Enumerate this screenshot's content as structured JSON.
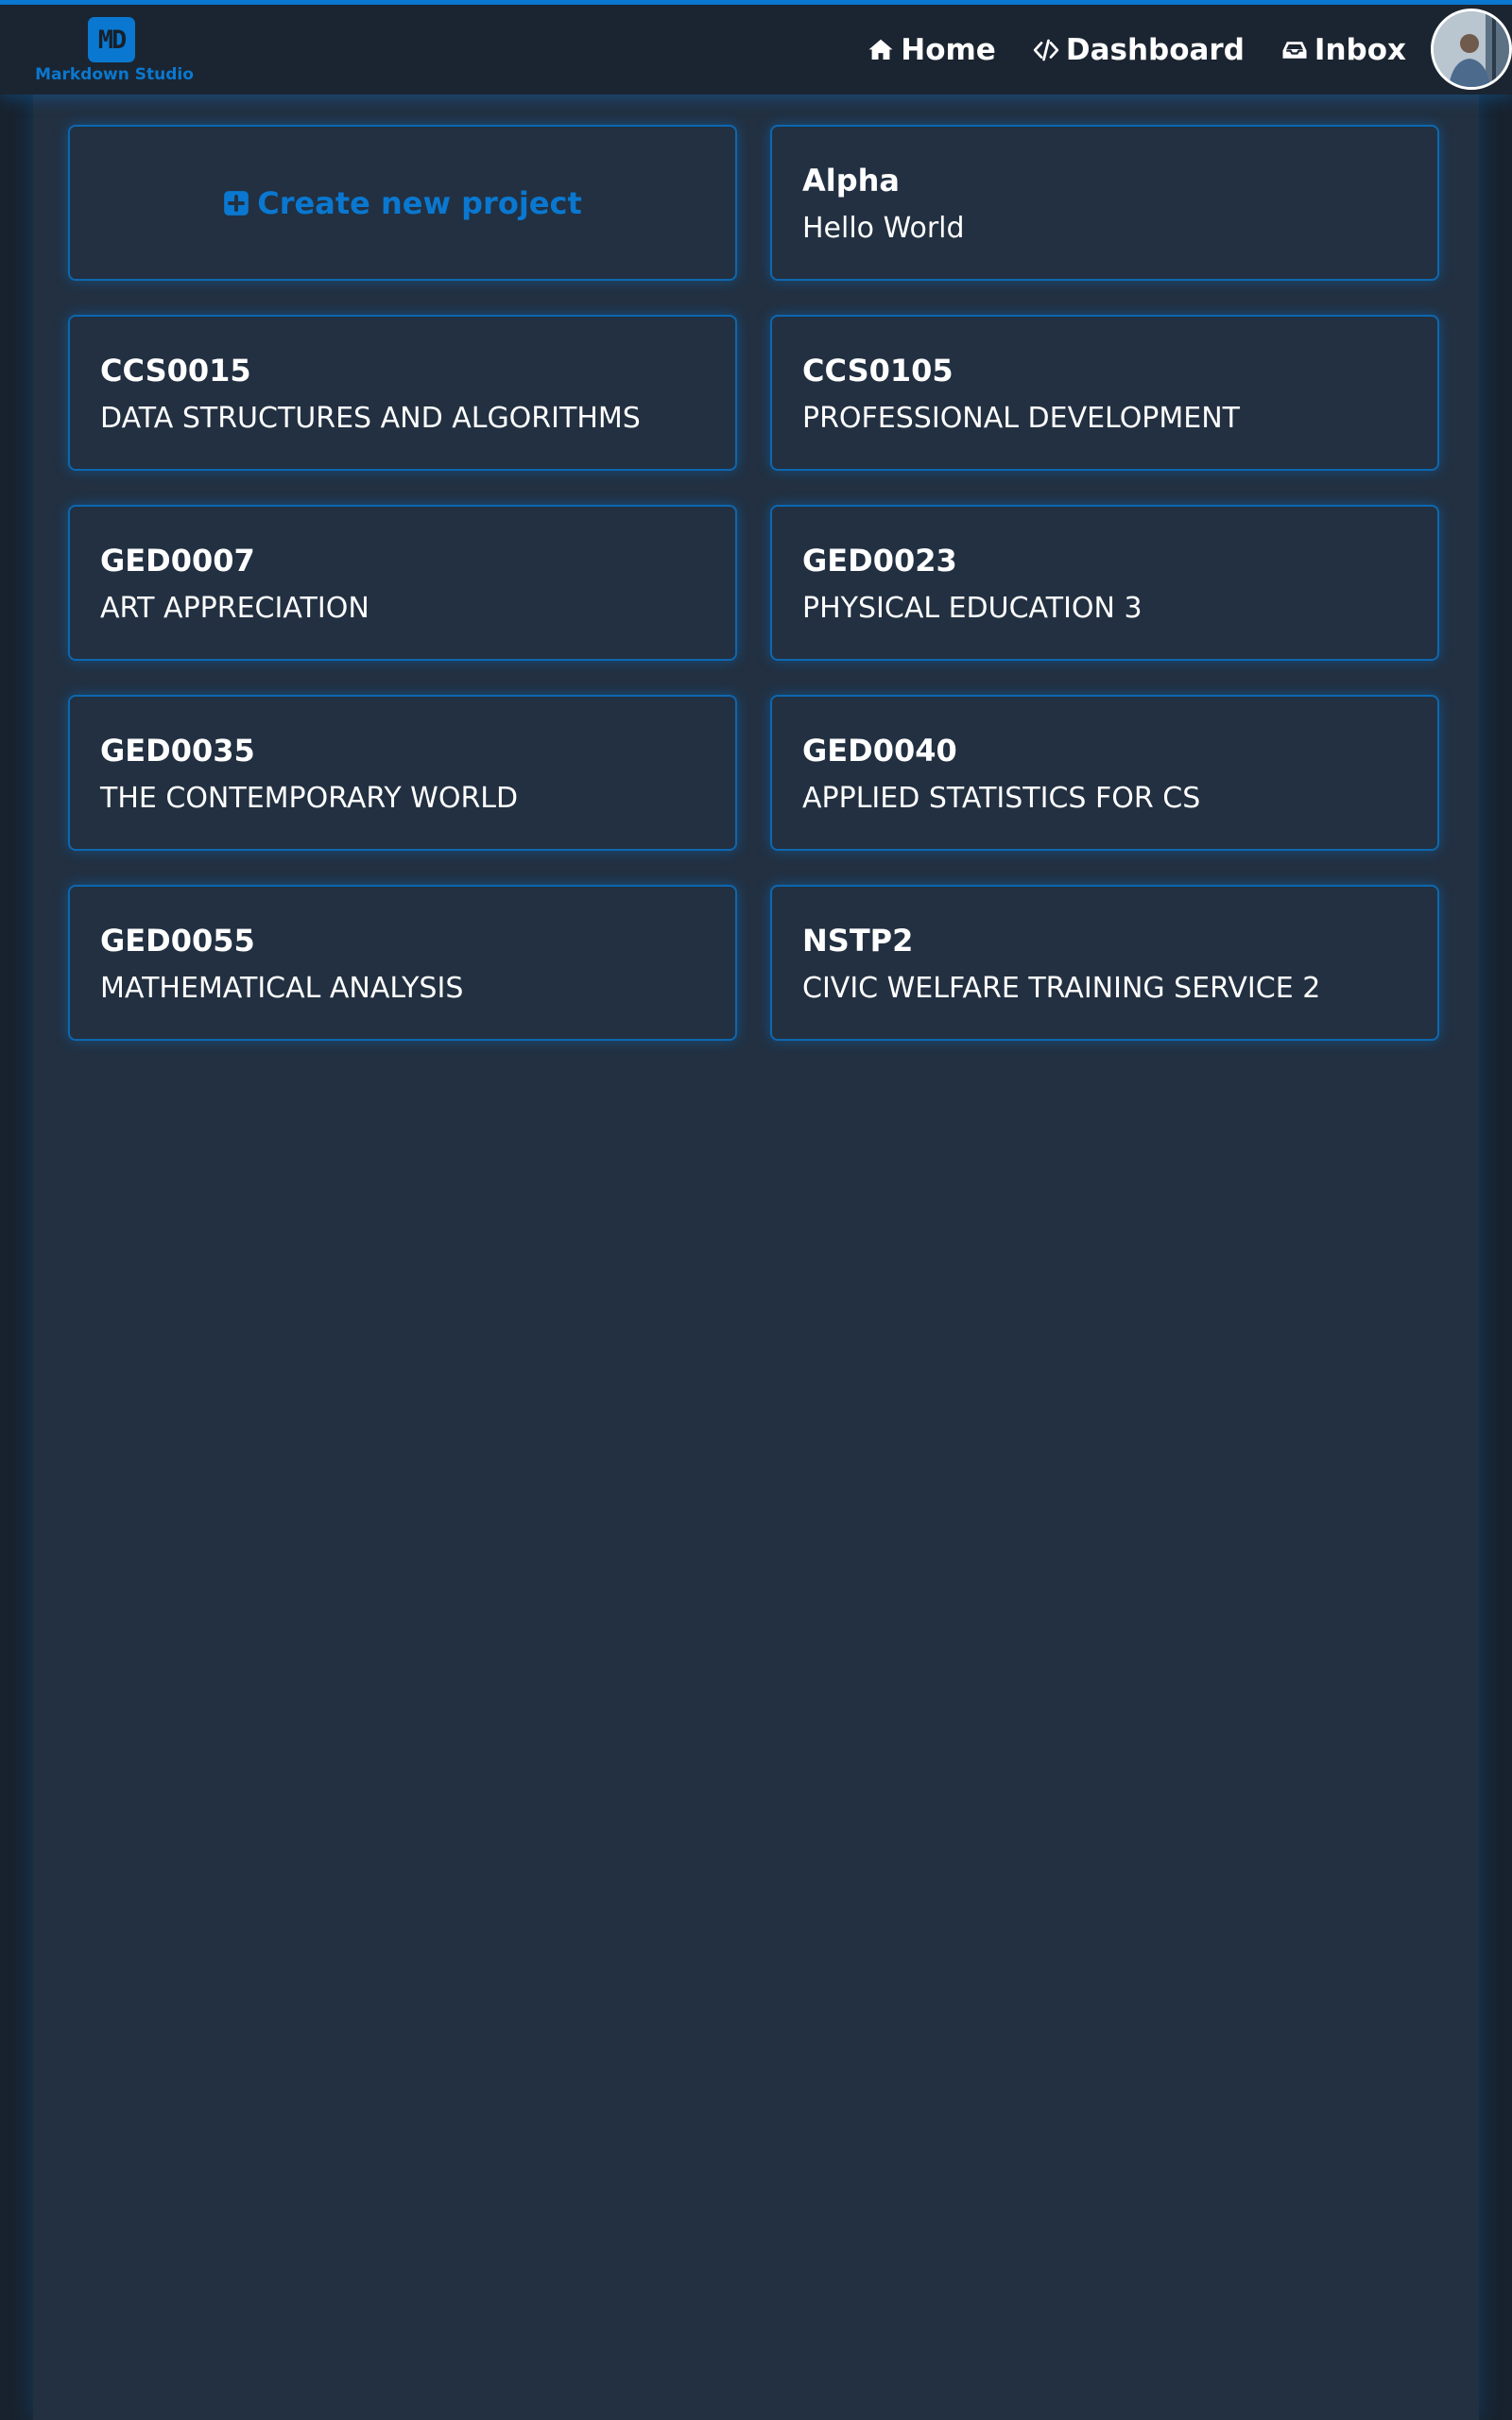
{
  "brand": {
    "logo_mark": "MD",
    "name": "Markdown  Studio",
    "accent_color": "#0a78d0"
  },
  "nav": {
    "items": [
      {
        "label": "Home",
        "icon": "home-icon"
      },
      {
        "label": "Dashboard",
        "icon": "code-icon"
      },
      {
        "label": "Inbox",
        "icon": "inbox-icon"
      }
    ],
    "avatar_icon": "user-avatar"
  },
  "create_card": {
    "label": "Create new project",
    "icon": "plus-square-icon"
  },
  "projects": [
    {
      "code": "Alpha",
      "title": "Hello World"
    },
    {
      "code": "CCS0015",
      "title": "DATA STRUCTURES AND ALGORITHMS"
    },
    {
      "code": "CCS0105",
      "title": "PROFESSIONAL DEVELOPMENT"
    },
    {
      "code": "GED0007",
      "title": "ART APPRECIATION"
    },
    {
      "code": "GED0023",
      "title": "PHYSICAL EDUCATION 3"
    },
    {
      "code": "GED0035",
      "title": "THE CONTEMPORARY WORLD"
    },
    {
      "code": "GED0040",
      "title": "APPLIED STATISTICS FOR CS"
    },
    {
      "code": "GED0055",
      "title": "MATHEMATICAL ANALYSIS"
    },
    {
      "code": "NSTP2",
      "title": "CIVIC WELFARE TRAINING SERVICE 2"
    }
  ]
}
